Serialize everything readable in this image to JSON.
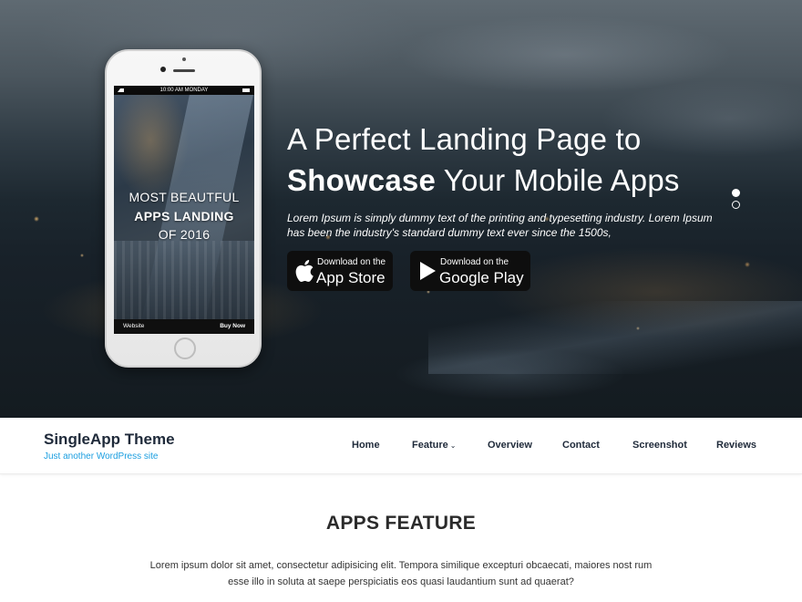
{
  "hero": {
    "phone": {
      "status_time": "10:00 AM MONDAY",
      "headline_line1": "MOST BEAUTFUL",
      "headline_line2": "APPS LANDING",
      "headline_line3": "OF 2016",
      "bottom_left": "Website",
      "bottom_right": "Buy Now"
    },
    "title_line1": "A Perfect Landing Page to",
    "title_bold": "Showcase",
    "title_rest": " Your Mobile Apps",
    "description": "Lorem Ipsum is simply dummy text of the printing and typesetting industry. Lorem Ipsum has been the industry's standard dummy text ever since the 1500s,",
    "app_store": {
      "small": "Download on the",
      "big": "App Store",
      "icon": "apple-icon"
    },
    "google_play": {
      "small": "Download on the",
      "big": "Google Play",
      "icon": "play-icon"
    },
    "slider": {
      "count": 2,
      "active": 0
    }
  },
  "nav": {
    "site_name": "SingleApp Theme",
    "tagline": "Just another WordPress site",
    "items": [
      {
        "label": "Home"
      },
      {
        "label": "Feature",
        "has_dropdown": true
      },
      {
        "label": "Overview"
      },
      {
        "label": "Contact"
      },
      {
        "label": "Screenshot"
      },
      {
        "label": "Reviews"
      }
    ]
  },
  "section": {
    "title": "APPS FEATURE",
    "text": "Lorem ipsum dolor sit amet, consectetur adipisicing elit. Tempora similique excepturi obcaecati, maiores nost rum esse illo in soluta at saepe perspiciatis eos quasi laudantium sunt ad quaerat?"
  },
  "colors": {
    "nav_text": "#1f2a3a",
    "tagline": "#1a9ee0",
    "store_button": "#0e0e0e"
  }
}
